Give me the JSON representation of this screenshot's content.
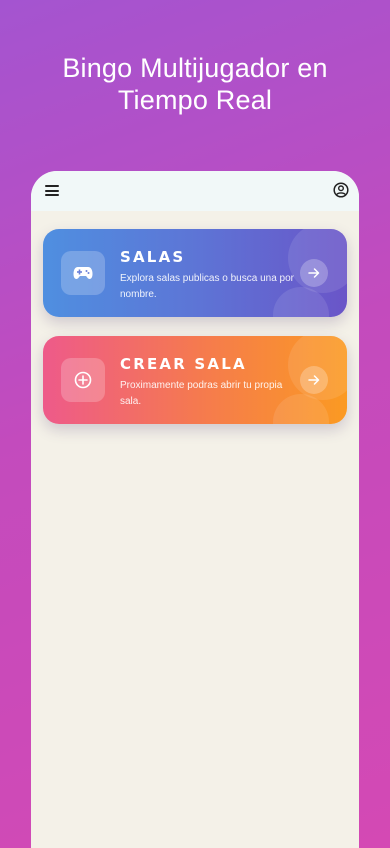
{
  "header": {
    "title_line1": "Bingo Multijugador en",
    "title_line2": "Tiempo Real"
  },
  "appbar": {
    "menu_icon": "menu-icon",
    "account_icon": "account-circle-icon"
  },
  "cards": [
    {
      "title": "SALAS",
      "description": "Explora salas publicas o busca una por nombre.",
      "icon": "gamepad-icon",
      "action_icon": "arrow-right-icon",
      "gradient": [
        "#4f8fe0",
        "#6a55c8"
      ]
    },
    {
      "title": "CREAR SALA",
      "description": "Proximamente podras abrir tu propia sala.",
      "icon": "add-circle-icon",
      "action_icon": "arrow-right-icon",
      "gradient": [
        "#ee5a8a",
        "#fb9a22"
      ]
    }
  ],
  "colors": {
    "background_start": "#a454d0",
    "background_end": "#d449b4",
    "surface": "#f4f1e8",
    "appbar": "#f1f8f8"
  }
}
